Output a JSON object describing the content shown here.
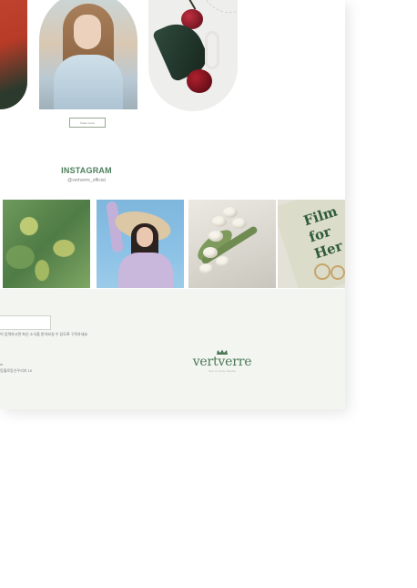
{
  "cards": {
    "view_more_label": "View more"
  },
  "instagram": {
    "title": "INSTAGRAM",
    "handle": "@vertverre_official",
    "photos": [
      "water-ripple-photo",
      "sunhat-girl-photo",
      "tulips-photo",
      "film-book-photo"
    ]
  },
  "photo_book": {
    "text": "Film\nfor\nHer"
  },
  "footer": {
    "newsletter_note": "이 입력하시면 최신 소식을 받아보실 수 있도록 구독하세요.",
    "address_line1": "m",
    "address_line2": "동월로동신우리지 10",
    "brand": "vertverre",
    "brand_tagline": "Vert et Verre Studio"
  },
  "colors": {
    "accent_green": "#4e7f5c",
    "footer_bg": "#f3f5f1"
  }
}
